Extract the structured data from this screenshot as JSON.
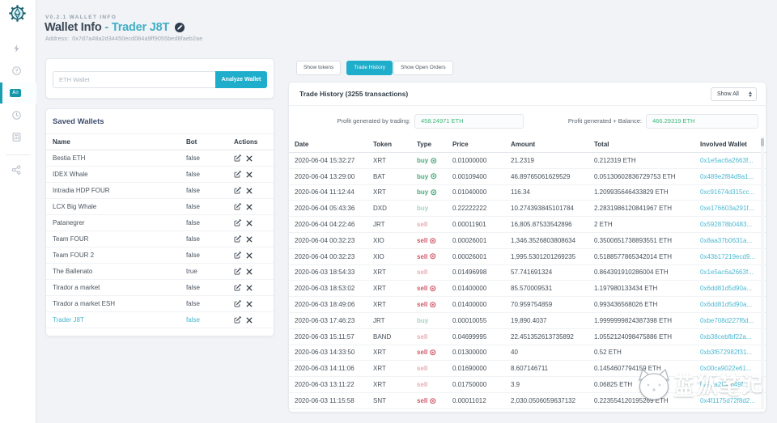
{
  "app": {
    "version_label": "V0.2.1 WALLET INFO",
    "title_main": "Wallet Info ",
    "title_wallet": "- Trader J8T",
    "address_label": "Address:",
    "address_value": "0x7d7a48a2d34450ecd084a9ff9055bed8faeb2ae"
  },
  "colors": {
    "accent": "#1eadca",
    "link": "#4fb9d1",
    "buy_green": "#4aa87c",
    "sell_red": "#cf5a6c",
    "profit_green": "#3eb878",
    "navy_heading": "#3c4857",
    "page_bg": "#f1f3f6"
  },
  "sidebar": {
    "logo": "gear-ethereum-logo",
    "items": [
      {
        "icon": "lightning-icon",
        "active": false
      },
      {
        "icon": "question-circle-icon",
        "active": false
      },
      {
        "icon": "address-card-icon",
        "active": true
      },
      {
        "icon": "clock-icon",
        "active": false
      },
      {
        "icon": "calculator-icon",
        "active": false
      },
      {
        "icon": "share-nodes-icon",
        "active": false
      }
    ]
  },
  "search": {
    "placeholder": "ETH Wallet",
    "button_label": "Analyze Wallet"
  },
  "saved_wallets": {
    "title": "Saved Wallets",
    "columns": {
      "name": "Name",
      "bot": "Bot",
      "actions": "Actions"
    },
    "rows": [
      {
        "name": "Bestia ETH",
        "bot": "false",
        "active": false
      },
      {
        "name": "IDEX Whale",
        "bot": "false",
        "active": false
      },
      {
        "name": "Intradia HDP FOUR",
        "bot": "false",
        "active": false
      },
      {
        "name": "LCX Big Whale",
        "bot": "false",
        "active": false
      },
      {
        "name": "Patanegrer",
        "bot": "false",
        "active": false
      },
      {
        "name": "Team FOUR",
        "bot": "false",
        "active": false
      },
      {
        "name": "Team FOUR 2",
        "bot": "false",
        "active": false
      },
      {
        "name": "The Ballenato",
        "bot": "true",
        "active": false
      },
      {
        "name": "Tirador a market",
        "bot": "false",
        "active": false
      },
      {
        "name": "Tirador a market ESH",
        "bot": "false",
        "active": false
      },
      {
        "name": "Trader J8T",
        "bot": "false",
        "active": true
      }
    ]
  },
  "tabs": [
    {
      "label": "Show tokens",
      "active": false
    },
    {
      "label": "Trade History",
      "active": true
    },
    {
      "label": "Show Open Orders",
      "active": false
    }
  ],
  "trade_history": {
    "title": "Trade History (3255 transactions)",
    "filter_value": "Show All",
    "profit_trading_label": "Profit generated by trading:",
    "profit_trading_value": "458.24971 ETH",
    "profit_balance_label": "Profit generated + Balance:",
    "profit_balance_value": "466.29319 ETH",
    "columns": {
      "date": "Date",
      "token": "Token",
      "type": "Type",
      "price": "Price",
      "amount": "Amount",
      "total": "Total",
      "wallet": "Involved Wallet"
    },
    "rows": [
      {
        "date": "2020-06-04 15:32:27",
        "token": "XRT",
        "type": "buy",
        "type_icon": true,
        "price": "0.01000000",
        "amount": "21.2319",
        "total": "0.212319 ETH",
        "wallet": "0x1e5ac6a2663f..."
      },
      {
        "date": "2020-06-04 13:29:00",
        "token": "BAT",
        "type": "buy",
        "type_icon": true,
        "price": "0.00109400",
        "amount": "46.89765061629529",
        "total": "0.05130602836729753 ETH",
        "wallet": "0x489e2f84d9a1..."
      },
      {
        "date": "2020-06-04 11:12:44",
        "token": "XRT",
        "type": "buy",
        "type_icon": true,
        "price": "0.01040000",
        "amount": "116.34",
        "total": "1.209935646433829 ETH",
        "wallet": "0xc91674d315cc..."
      },
      {
        "date": "2020-06-04 05:43:36",
        "token": "DXD",
        "type": "buy",
        "type_icon": false,
        "price": "0.22222222",
        "amount": "10.274393845101784",
        "total": "2.2831986120841967 ETH",
        "wallet": "0xe176603a291f..."
      },
      {
        "date": "2020-06-04 04:22:46",
        "token": "JRT",
        "type": "sell",
        "type_icon": false,
        "price": "0.00011901",
        "amount": "16,805.87533542896",
        "total": "2 ETH",
        "wallet": "0x592878b0483..."
      },
      {
        "date": "2020-06-04 00:32:23",
        "token": "XIO",
        "type": "sell",
        "type_icon": true,
        "price": "0.00026001",
        "amount": "1,346.3526803808634",
        "total": "0.3500651738893551 ETH",
        "wallet": "0x8aa37b0631a..."
      },
      {
        "date": "2020-06-04 00:32:23",
        "token": "XIO",
        "type": "sell",
        "type_icon": true,
        "price": "0.00026001",
        "amount": "1,995.5301201269235",
        "total": "0.5188577865342014 ETH",
        "wallet": "0x43b17219ecd9..."
      },
      {
        "date": "2020-06-03 18:54:33",
        "token": "XRT",
        "type": "sell",
        "type_icon": false,
        "price": "0.01496998",
        "amount": "57.741691324",
        "total": "0.864391910286004 ETH",
        "wallet": "0x1e5ac6a2663f..."
      },
      {
        "date": "2020-06-03 18:53:02",
        "token": "XRT",
        "type": "sell",
        "type_icon": true,
        "price": "0.01400000",
        "amount": "85.570009531",
        "total": "1.197980133434 ETH",
        "wallet": "0x6dd81d5d90a..."
      },
      {
        "date": "2020-06-03 18:49:06",
        "token": "XRT",
        "type": "sell",
        "type_icon": true,
        "price": "0.01400000",
        "amount": "70.959754859",
        "total": "0.993436568026 ETH",
        "wallet": "0x6dd81d5d90a..."
      },
      {
        "date": "2020-06-03 17:46:23",
        "token": "JRT",
        "type": "buy",
        "type_icon": false,
        "price": "0.00010055",
        "amount": "19,890.4037",
        "total": "1.9999999824387398 ETH",
        "wallet": "0xbe708d227f6d..."
      },
      {
        "date": "2020-06-03 15:11:57",
        "token": "BAND",
        "type": "sell",
        "type_icon": false,
        "price": "0.04699995",
        "amount": "22.451352613735892",
        "total": "1.0552124098475886 ETH",
        "wallet": "0xb38cebfbf22a..."
      },
      {
        "date": "2020-06-03 14:33:50",
        "token": "XRT",
        "type": "sell",
        "type_icon": true,
        "price": "0.01300000",
        "amount": "40",
        "total": "0.52 ETH",
        "wallet": "0xb3f672982f31..."
      },
      {
        "date": "2020-06-03 14:11:06",
        "token": "XRT",
        "type": "sell",
        "type_icon": false,
        "price": "0.01690000",
        "amount": "8.607146711",
        "total": "0.1454607794159 ETH",
        "wallet": "0x00ca9022e61..."
      },
      {
        "date": "2020-06-03 13:11:22",
        "token": "XRT",
        "type": "sell",
        "type_icon": false,
        "price": "0.01750000",
        "amount": "3.9",
        "total": "0.06825 ETH",
        "wallet": "0x92a2f6db49f..."
      },
      {
        "date": "2020-06-03 11:15:58",
        "token": "SNT",
        "type": "sell",
        "type_icon": true,
        "price": "0.00011012",
        "amount": "2,030.0506059637132",
        "total": "0.223554120195269 ETH",
        "wallet": "0x4f1175d72f8d2..."
      }
    ]
  },
  "watermark": {
    "text": "蓝狐笔记",
    "logo": "fox-logo"
  }
}
